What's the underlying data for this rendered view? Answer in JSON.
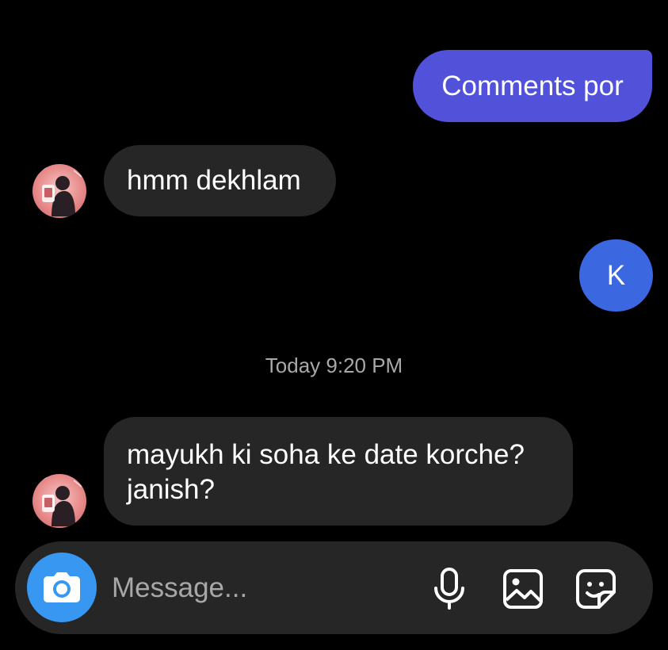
{
  "messages": [
    {
      "direction": "outgoing",
      "text": "Comments por"
    },
    {
      "direction": "incoming",
      "text": "hmm dekhlam"
    },
    {
      "direction": "outgoing",
      "text": "K"
    },
    {
      "direction": "incoming",
      "lines": [
        "mayukh ki soha ke date korche?",
        "janish?"
      ]
    }
  ],
  "timestamp": "Today 9:20 PM",
  "composer": {
    "placeholder": "Message...",
    "icons": {
      "camera": "camera-icon",
      "mic": "microphone-icon",
      "gallery": "image-icon",
      "sticker": "sticker-icon"
    }
  },
  "colors": {
    "background": "#000000",
    "outgoing_primary": "#5152d9",
    "outgoing_secondary": "#3b67e0",
    "incoming": "#262626",
    "camera_button": "#3897f0",
    "timestamp_text": "#a8a8a8"
  }
}
